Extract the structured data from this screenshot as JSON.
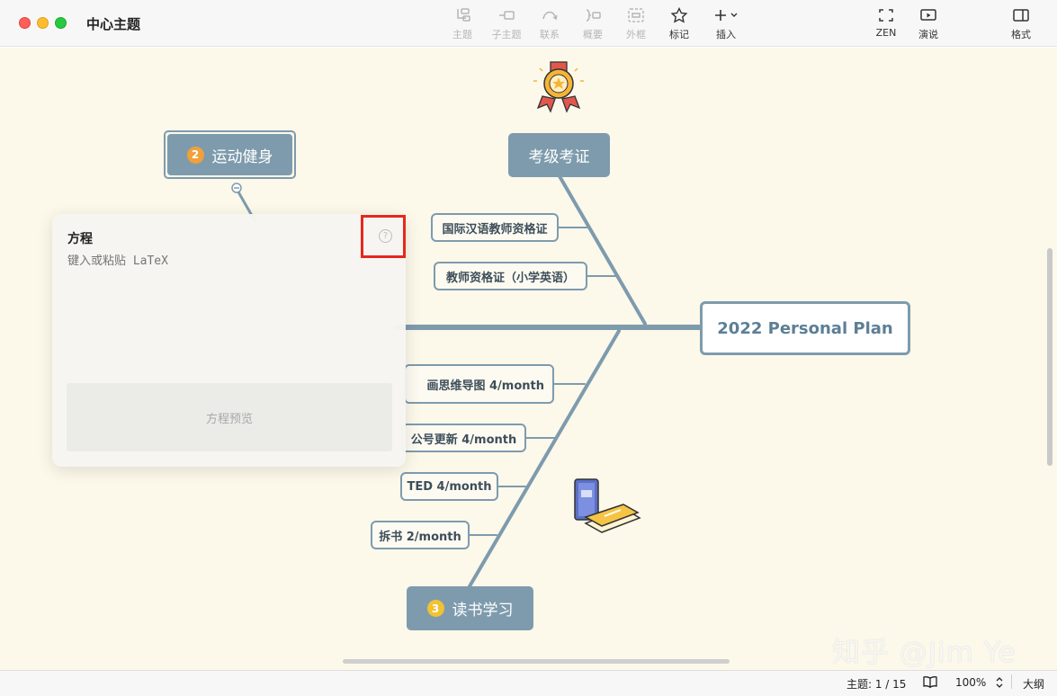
{
  "window": {
    "title": "中心主题"
  },
  "toolbar": {
    "topic": "主题",
    "subtopic": "子主题",
    "relationship": "联系",
    "summary": "概要",
    "boundary": "外框",
    "marker": "标记",
    "insert": "插入",
    "zen": "ZEN",
    "present": "演说",
    "format": "格式"
  },
  "mindmap": {
    "central": "2022 Personal Plan",
    "topics": [
      {
        "badge": "2",
        "label": "运动健身",
        "badge_color": "#f0a13a"
      },
      {
        "badge": "",
        "label": "考级考证"
      },
      {
        "badge": "3",
        "label": "读书学习",
        "badge_color": "#f1c232"
      }
    ],
    "subtopics": {
      "cert1": "国际汉语教师资格证",
      "cert2": "教师资格证（小学英语）",
      "read1": "画思维导图 4/month",
      "read2": "公号更新 4/month",
      "read3": "TED 4/month",
      "read4": "拆书 2/month"
    },
    "colors": {
      "branch": "#7e9bad",
      "canvas": "#fcf8ea"
    }
  },
  "equation_popup": {
    "title": "方程",
    "placeholder": "键入或粘贴 LaTeX",
    "preview": "方程预览",
    "help": "?"
  },
  "statusbar": {
    "topic_count": "主题: 1 / 15",
    "zoom": "100%",
    "outline": "大纲"
  },
  "watermark": "知乎 @Jim Ye"
}
